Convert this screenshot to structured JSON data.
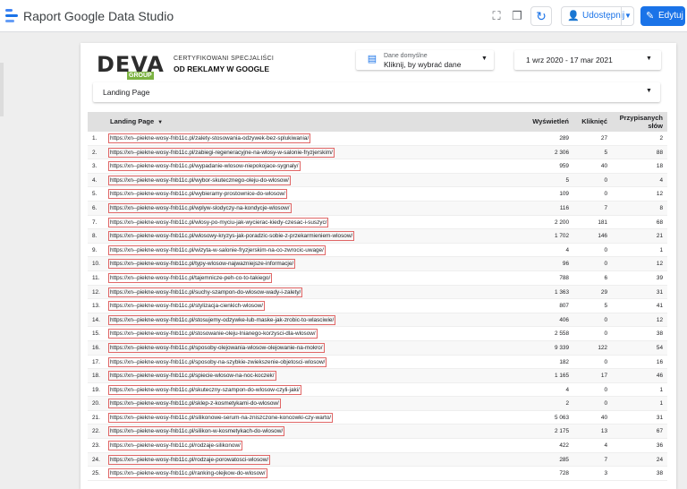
{
  "app": {
    "title": "Raport Google Data Studio",
    "share_label": "Udostępnij",
    "edit_label": "Edytuj"
  },
  "brand": {
    "mark": "DEVA",
    "sub": "GROUP",
    "line1": "CERTYFIKOWANI SPECJALIŚCI",
    "line2": "OD REKLAMY W GOOGLE"
  },
  "controls": {
    "datasource_title": "Dane domyślne",
    "datasource_value": "Kliknij, by wybrać dane",
    "date_range": "1 wrz 2020 - 17 mar 2021",
    "filter_label": "Landing Page"
  },
  "icons": {
    "fullscreen": "fullscreen-icon",
    "copy": "copy-icon",
    "refresh": "refresh-icon",
    "share": "add-person-icon",
    "edit": "pencil-icon",
    "datasource": "database-icon",
    "dropdown": "triangle-down-icon"
  },
  "colors": {
    "accent": "#1a73e8",
    "url_border": "#e06666",
    "header_bg": "#e0e0e0"
  },
  "table": {
    "headers": {
      "landing_page": "Landing Page",
      "views": "Wyświetleń",
      "clicks": "Kliknięć",
      "words": "Przypisanych słów"
    },
    "rows": [
      {
        "idx": "1.",
        "url": "https://xn--piekne-wosy-fnb11c.pl/zalety-stosowania-odzywek-bez-splukiwania/",
        "views": "289",
        "clicks": "27",
        "words": "2"
      },
      {
        "idx": "2.",
        "url": "https://xn--piekne-wosy-fnb11c.pl/zabiegi-regeneracyjne-na-wlosy-w-salonie-fryzjerskim/",
        "views": "2 306",
        "clicks": "5",
        "words": "88"
      },
      {
        "idx": "3.",
        "url": "https://xn--piekne-wosy-fnb11c.pl/wypadanie-wlosow-niepokojace-sygnaly/",
        "views": "959",
        "clicks": "40",
        "words": "18"
      },
      {
        "idx": "4.",
        "url": "https://xn--piekne-wosy-fnb11c.pl/wybor-skutecznego-oleju-do-wlosow/",
        "views": "5",
        "clicks": "0",
        "words": "4"
      },
      {
        "idx": "5.",
        "url": "https://xn--piekne-wosy-fnb11c.pl/wybieramy-prostownice-do-wlosow/",
        "views": "109",
        "clicks": "0",
        "words": "12"
      },
      {
        "idx": "6.",
        "url": "https://xn--piekne-wosy-fnb11c.pl/wplyw-slodyczy-na-kondycje-wlosow/",
        "views": "116",
        "clicks": "7",
        "words": "8"
      },
      {
        "idx": "7.",
        "url": "https://xn--piekne-wosy-fnb11c.pl/wlosy-po-myciu-jak-wycierac-kiedy-czesac-i-suszyc/",
        "views": "2 200",
        "clicks": "181",
        "words": "68"
      },
      {
        "idx": "8.",
        "url": "https://xn--piekne-wosy-fnb11c.pl/wlosowy-kryzys-jak-poradzic-sobie-z-przekarmieniem-wlosow/",
        "views": "1 702",
        "clicks": "146",
        "words": "21"
      },
      {
        "idx": "9.",
        "url": "https://xn--piekne-wosy-fnb11c.pl/wizyta-w-salonie-fryzjerskim-na-co-zwrocic-uwage/",
        "views": "4",
        "clicks": "0",
        "words": "1"
      },
      {
        "idx": "10.",
        "url": "https://xn--piekne-wosy-fnb11c.pl/typy-wlosow-najwazniejsze-informacje/",
        "views": "96",
        "clicks": "0",
        "words": "12"
      },
      {
        "idx": "11.",
        "url": "https://xn--piekne-wosy-fnb11c.pl/tajemnicze-peh-co-to-takiego/",
        "views": "788",
        "clicks": "6",
        "words": "39"
      },
      {
        "idx": "12.",
        "url": "https://xn--piekne-wosy-fnb11c.pl/suchy-szampon-do-wlosow-wady-i-zalety/",
        "views": "1 363",
        "clicks": "29",
        "words": "31"
      },
      {
        "idx": "13.",
        "url": "https://xn--piekne-wosy-fnb11c.pl/stylizacja-cienkich-wlosow/",
        "views": "807",
        "clicks": "5",
        "words": "41"
      },
      {
        "idx": "14.",
        "url": "https://xn--piekne-wosy-fnb11c.pl/stosujemy-odzywke-lub-maske-jak-zrobic-to-wlasciwie/",
        "views": "406",
        "clicks": "0",
        "words": "12"
      },
      {
        "idx": "15.",
        "url": "https://xn--piekne-wosy-fnb11c.pl/stosowanie-oleju-lnianego-korzysci-dla-wlosow/",
        "views": "2 558",
        "clicks": "0",
        "words": "38"
      },
      {
        "idx": "16.",
        "url": "https://xn--piekne-wosy-fnb11c.pl/sposoby-olejowania-wlosow-olejowanie-na-mokro/",
        "views": "9 339",
        "clicks": "122",
        "words": "54"
      },
      {
        "idx": "17.",
        "url": "https://xn--piekne-wosy-fnb11c.pl/sposoby-na-szybkie-zwiekszenie-objetosci-wlosow/",
        "views": "182",
        "clicks": "0",
        "words": "16"
      },
      {
        "idx": "18.",
        "url": "https://xn--piekne-wosy-fnb11c.pl/spiecie-wlosow-na-noc-koczek/",
        "views": "1 165",
        "clicks": "17",
        "words": "46"
      },
      {
        "idx": "19.",
        "url": "https://xn--piekne-wosy-fnb11c.pl/skuteczny-szampon-do-wlosow-czyli-jaki/",
        "views": "4",
        "clicks": "0",
        "words": "1"
      },
      {
        "idx": "20.",
        "url": "https://xn--piekne-wosy-fnb11c.pl/sklep-z-kosmetykami-do-wlosow/",
        "views": "2",
        "clicks": "0",
        "words": "1"
      },
      {
        "idx": "21.",
        "url": "https://xn--piekne-wosy-fnb11c.pl/silikonowe-serum-na-zniszczone-koncowki-czy-warto/",
        "views": "5 063",
        "clicks": "40",
        "words": "31"
      },
      {
        "idx": "22.",
        "url": "https://xn--piekne-wosy-fnb11c.pl/silikon-w-kosmetykach-do-wlosow/",
        "views": "2 175",
        "clicks": "13",
        "words": "67"
      },
      {
        "idx": "23.",
        "url": "https://xn--piekne-wosy-fnb11c.pl/rodzaje-silikonow/",
        "views": "422",
        "clicks": "4",
        "words": "36"
      },
      {
        "idx": "24.",
        "url": "https://xn--piekne-wosy-fnb11c.pl/rodzaje-porowatosci-wlosow/",
        "views": "285",
        "clicks": "7",
        "words": "24"
      },
      {
        "idx": "25.",
        "url": "https://xn--piekne-wosy-fnb11c.pl/ranking-olejkow-do-wlosow/",
        "views": "728",
        "clicks": "3",
        "words": "38"
      }
    ]
  }
}
